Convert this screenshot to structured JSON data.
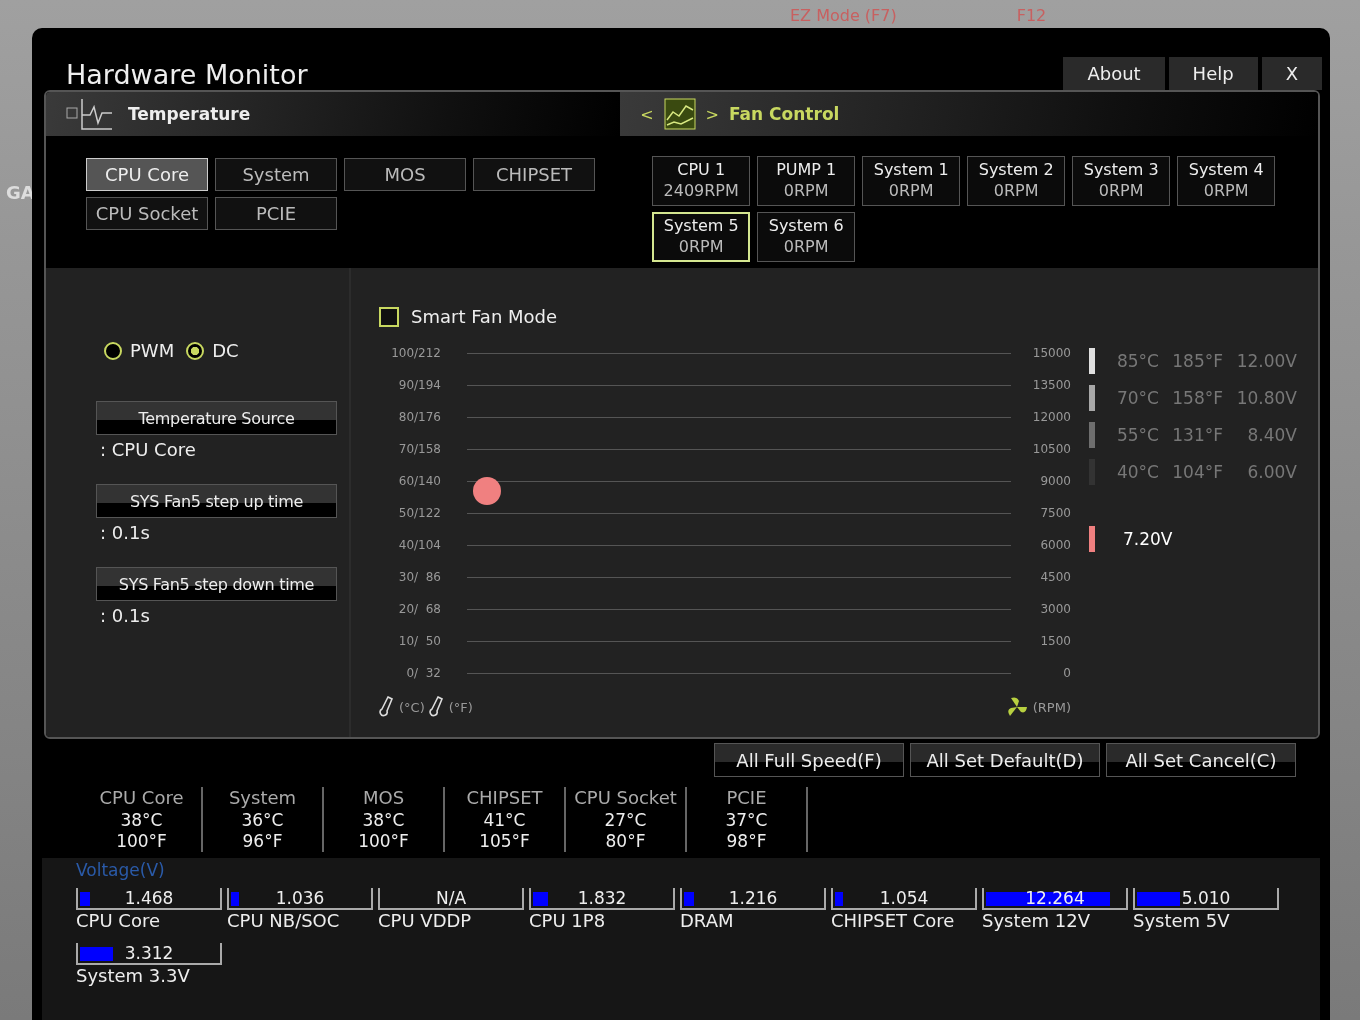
{
  "background": {
    "top_items": [
      "EZ Mode (F7)",
      "F12"
    ],
    "side_tab": "GA"
  },
  "window": {
    "title": "Hardware Monitor",
    "tabs": [
      {
        "label": "About"
      },
      {
        "label": "Help"
      },
      {
        "label": "X"
      }
    ]
  },
  "temperature": {
    "title": "Temperature",
    "sensors": [
      {
        "label": "CPU Core",
        "selected": true
      },
      {
        "label": "System",
        "selected": false
      },
      {
        "label": "MOS",
        "selected": false
      },
      {
        "label": "CHIPSET",
        "selected": false
      },
      {
        "label": "CPU Socket",
        "selected": false
      },
      {
        "label": "PCIE",
        "selected": false
      }
    ]
  },
  "fan_control": {
    "title": "Fan Control",
    "prev": "<",
    "next": ">",
    "fans": [
      {
        "name": "CPU 1",
        "speed": "2409RPM",
        "selected": false
      },
      {
        "name": "PUMP 1",
        "speed": "0RPM",
        "selected": false
      },
      {
        "name": "System 1",
        "speed": "0RPM",
        "selected": false
      },
      {
        "name": "System 2",
        "speed": "0RPM",
        "selected": false
      },
      {
        "name": "System 3",
        "speed": "0RPM",
        "selected": false
      },
      {
        "name": "System 4",
        "speed": "0RPM",
        "selected": false
      },
      {
        "name": "System 5",
        "speed": "0RPM",
        "selected": true
      },
      {
        "name": "System 6",
        "speed": "0RPM",
        "selected": false
      }
    ]
  },
  "mode": [
    {
      "label": "PWM",
      "selected": false
    },
    {
      "label": "DC",
      "selected": true
    }
  ],
  "settings": [
    {
      "label": "Temperature Source",
      "value": ": CPU Core"
    },
    {
      "label": "SYS Fan5 step up time",
      "value": ": 0.1s"
    },
    {
      "label": "SYS Fan5 step down time",
      "value": ": 0.1s"
    }
  ],
  "smart_fan": {
    "label": "Smart Fan Mode",
    "checked": false
  },
  "curve": {
    "temp_ticks": [
      "100/212",
      "90/194",
      "80/176",
      "70/158",
      "60/140",
      "50/122",
      "40/104",
      "30/  86",
      "20/  68",
      "10/  50",
      "0/  32"
    ],
    "rpm_ticks": [
      "15000",
      "13500",
      "12000",
      "10500",
      "9000",
      "7500",
      "6000",
      "4500",
      "3000",
      "1500",
      "0"
    ],
    "temp_units": [
      "(°C)",
      "(°F)"
    ],
    "rpm_unit": "(RPM)"
  },
  "legend": [
    {
      "color": "#e0e0e0",
      "celsius": "85°C",
      "fahrenheit": "185°F",
      "voltage": "12.00V"
    },
    {
      "color": "#a8a8a8",
      "celsius": "70°C",
      "fahrenheit": "158°F",
      "voltage": "10.80V"
    },
    {
      "color": "#6e6e6e",
      "celsius": "55°C",
      "fahrenheit": "131°F",
      "voltage": "8.40V"
    },
    {
      "color": "#333333",
      "celsius": "40°C",
      "fahrenheit": "104°F",
      "voltage": "6.00V"
    }
  ],
  "current": {
    "color": "#f08080",
    "voltage": "7.20V"
  },
  "actions": [
    "All Full Speed(F)",
    "All Set Default(D)",
    "All Set Cancel(C)"
  ],
  "readings": [
    {
      "name": "CPU Core",
      "celsius": "38°C",
      "fahrenheit": "100°F"
    },
    {
      "name": "System",
      "celsius": "36°C",
      "fahrenheit": "96°F"
    },
    {
      "name": "MOS",
      "celsius": "38°C",
      "fahrenheit": "100°F"
    },
    {
      "name": "CHIPSET",
      "celsius": "41°C",
      "fahrenheit": "105°F"
    },
    {
      "name": "CPU Socket",
      "celsius": "27°C",
      "fahrenheit": "80°F"
    },
    {
      "name": "PCIE",
      "celsius": "37°C",
      "fahrenheit": "98°F"
    }
  ],
  "voltage": {
    "title": "Voltage(V)",
    "rails": [
      {
        "name": "CPU Core",
        "value": "1.468",
        "level": 0.07
      },
      {
        "name": "CPU NB/SOC",
        "value": "1.036",
        "level": 0.06
      },
      {
        "name": "CPU VDDP",
        "value": "N/A"
      },
      {
        "name": "CPU 1P8",
        "value": "1.832",
        "level": 0.11
      },
      {
        "name": "DRAM",
        "value": "1.216",
        "level": 0.07
      },
      {
        "name": "CHIPSET Core",
        "value": "1.054",
        "level": 0.06
      },
      {
        "name": "System 12V",
        "value": "12.264",
        "level": 0.9
      },
      {
        "name": "System 5V",
        "value": "5.010",
        "level": 0.31
      },
      {
        "name": "System 3.3V",
        "value": "3.312",
        "level": 0.24
      }
    ]
  }
}
